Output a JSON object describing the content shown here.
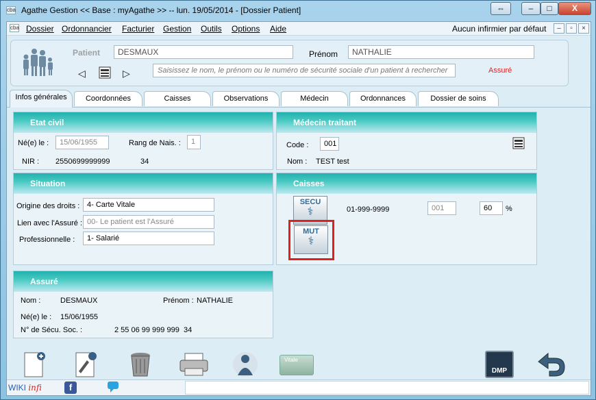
{
  "window": {
    "title": "Agathe Gestion << Base : myAgathe >>   --   lun. 19/05/2014  - [Dossier Patient]",
    "logo": "cba",
    "controls": [
      "⇔",
      "–",
      "□",
      "X"
    ]
  },
  "menu": {
    "logo": "cba",
    "items": [
      {
        "label": "Dossier"
      },
      {
        "label": "Ordonnancier"
      },
      {
        "label": "Facturier"
      },
      {
        "label": "Gestion"
      },
      {
        "label": "Outils"
      },
      {
        "label": "Options"
      },
      {
        "label": "Aide"
      }
    ],
    "infirmier": "Aucun infirmier par défaut",
    "mdi_controls": [
      "–",
      "▫",
      "×"
    ]
  },
  "patient": {
    "label_patient": "Patient",
    "nom": "DESMAUX",
    "label_prenom": "Prénom",
    "prenom": "NATHALIE",
    "search_placeholder": "Saisissez le nom, le prénom ou le numéro de sécurité sociale d'un patient à rechercher",
    "assure_label": "Assuré",
    "nav_prev": "◁",
    "nav_next": "▷"
  },
  "tabs": [
    {
      "label": "Infos générales",
      "active": true
    },
    {
      "label": "Coordonnées"
    },
    {
      "label": "Caisses"
    },
    {
      "label": "Observations"
    },
    {
      "label": "Médecin"
    },
    {
      "label": "Ordonnances"
    },
    {
      "label": "Dossier de soins"
    }
  ],
  "etat_civil": {
    "title": "Etat civil",
    "ne_label": "Né(e) le :",
    "ne_value": "15/06/1955",
    "rang_label": "Rang de Nais. :",
    "rang_value": "1",
    "nir_label": "NIR :",
    "nir_value": "2550699999999",
    "nir_key": "34"
  },
  "medecin": {
    "title": "Médecin traitant",
    "code_label": "Code :",
    "code_value": "001",
    "nom_label": "Nom :",
    "nom_value": "TEST test"
  },
  "situation": {
    "title": "Situation",
    "origine_label": "Origine des droits :",
    "origine_value": "4- Carte Vitale",
    "lien_label": "Lien avec l'Assuré :",
    "lien_value": "00- Le patient est l'Assuré",
    "pro_label": "Professionnelle :",
    "pro_value": "1- Salarié"
  },
  "caisses": {
    "title": "Caisses",
    "secu_label": "SECU",
    "mut_label": "MUT",
    "caisse_code": "01-999-9999",
    "field_code": "001",
    "percent_value": "60",
    "percent_sign": "%"
  },
  "assure": {
    "title": "Assuré",
    "nom_label": "Nom :",
    "nom_value": "DESMAUX",
    "prenom_label": "Prénom :",
    "prenom_value": "NATHALIE",
    "ne_label": "Né(e) le :",
    "ne_value": "15/06/1955",
    "secu_label": "N° de Sécu. Soc. :",
    "secu_value": "2 55 06 99 999 999",
    "secu_key": "34"
  },
  "toolbar": {
    "vitale_text": "Vitale",
    "dmp_text": "DMP"
  },
  "status": {
    "wiki": "WIKI",
    "infi": "infi"
  },
  "colors": {
    "panel_header": "#22b1ad",
    "highlight_frame": "#e0201d",
    "assure_red": "#dd2222"
  }
}
